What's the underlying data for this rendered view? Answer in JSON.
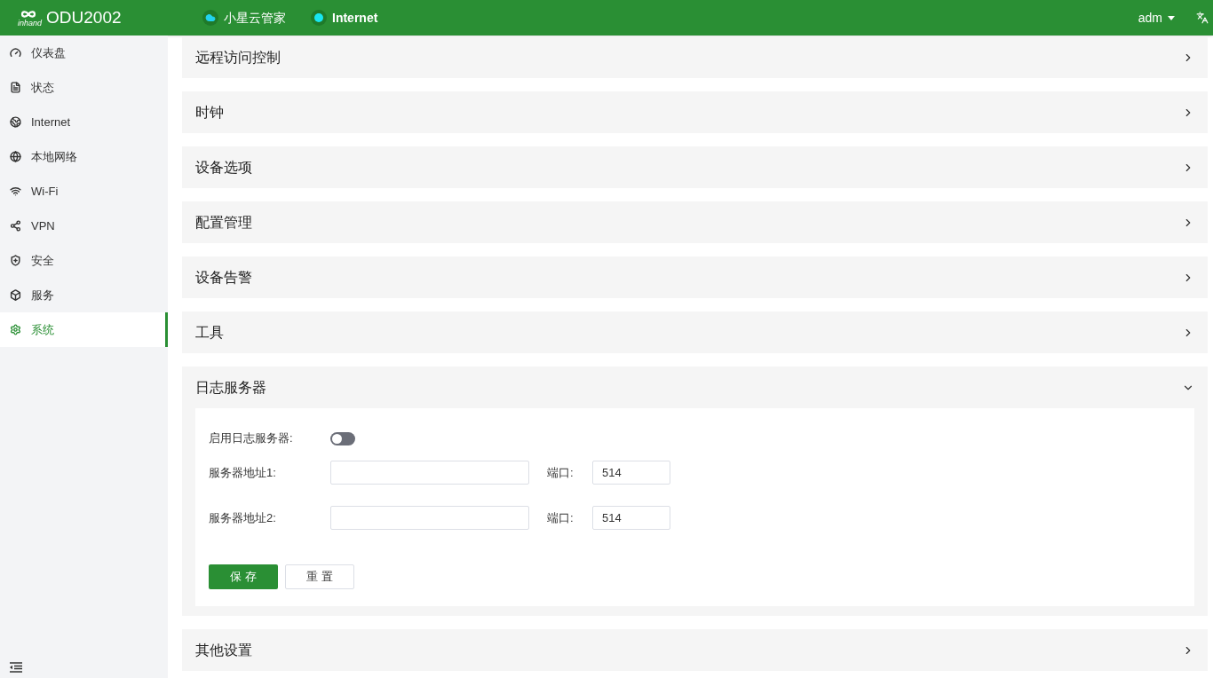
{
  "header": {
    "product": "ODU2002",
    "logo_text": "inhand",
    "cloud": "小星云管家",
    "internet": "Internet",
    "user": "adm"
  },
  "sidebar": {
    "items": [
      {
        "label": "仪表盘",
        "selected": false
      },
      {
        "label": "状态",
        "selected": false
      },
      {
        "label": "Internet",
        "selected": false
      },
      {
        "label": "本地网络",
        "selected": false
      },
      {
        "label": "Wi-Fi",
        "selected": false
      },
      {
        "label": "VPN",
        "selected": false
      },
      {
        "label": "安全",
        "selected": false
      },
      {
        "label": "服务",
        "selected": false
      },
      {
        "label": "系统",
        "selected": true
      }
    ]
  },
  "sections": [
    {
      "title": "远程访问控制",
      "expanded": false
    },
    {
      "title": "时钟",
      "expanded": false
    },
    {
      "title": "设备选项",
      "expanded": false
    },
    {
      "title": "配置管理",
      "expanded": false
    },
    {
      "title": "设备告警",
      "expanded": false
    },
    {
      "title": "工具",
      "expanded": false
    },
    {
      "title": "日志服务器",
      "expanded": true
    },
    {
      "title": "其他设置",
      "expanded": false
    }
  ],
  "log_server": {
    "enable_label": "启用日志服务器:",
    "enabled": false,
    "servers": [
      {
        "label": "服务器地址1:",
        "port_label": "端口:",
        "port": "514"
      },
      {
        "label": "服务器地址2:",
        "port_label": "端口:",
        "port": "514"
      }
    ],
    "save": "保 存",
    "reset": "重 置"
  }
}
